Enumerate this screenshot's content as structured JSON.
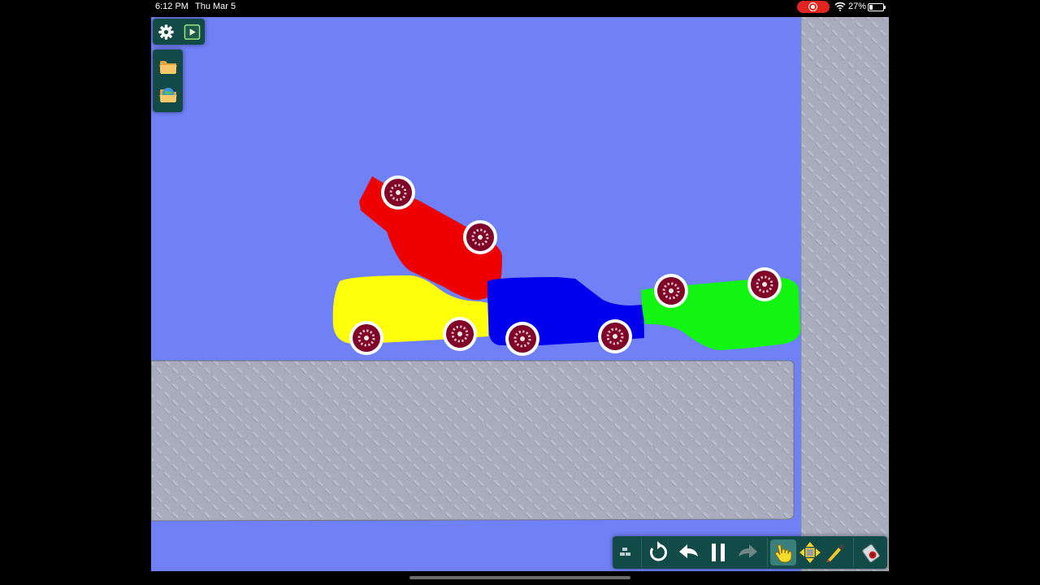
{
  "status_bar": {
    "time": "6:12 PM",
    "date": "Thu Mar 5",
    "battery_percent": "27%",
    "battery_level": 0.27,
    "recording": true
  },
  "top_panel": {
    "icons": [
      "gear-icon",
      "play-window-icon"
    ]
  },
  "left_panel": {
    "icons": [
      "folder-icon",
      "scene-folder-icon"
    ]
  },
  "scene": {
    "background_color": "#7080f7",
    "ground_color": "#a8acbc",
    "cars": [
      {
        "name": "red-car",
        "color": "#ee0000"
      },
      {
        "name": "yellow-car",
        "color": "#ffff0a"
      },
      {
        "name": "blue-car",
        "color": "#0000ee"
      },
      {
        "name": "green-car",
        "color": "#11f511"
      }
    ],
    "wheel_color": "#800028"
  },
  "toolbar": {
    "tools": [
      "grid-icon",
      "reset-icon",
      "undo-icon",
      "pause-icon",
      "redo-icon",
      "hand-tool-icon",
      "move-tool-icon",
      "brush-tool-icon",
      "eraser-icon"
    ],
    "active_tool": "hand-tool-icon"
  }
}
